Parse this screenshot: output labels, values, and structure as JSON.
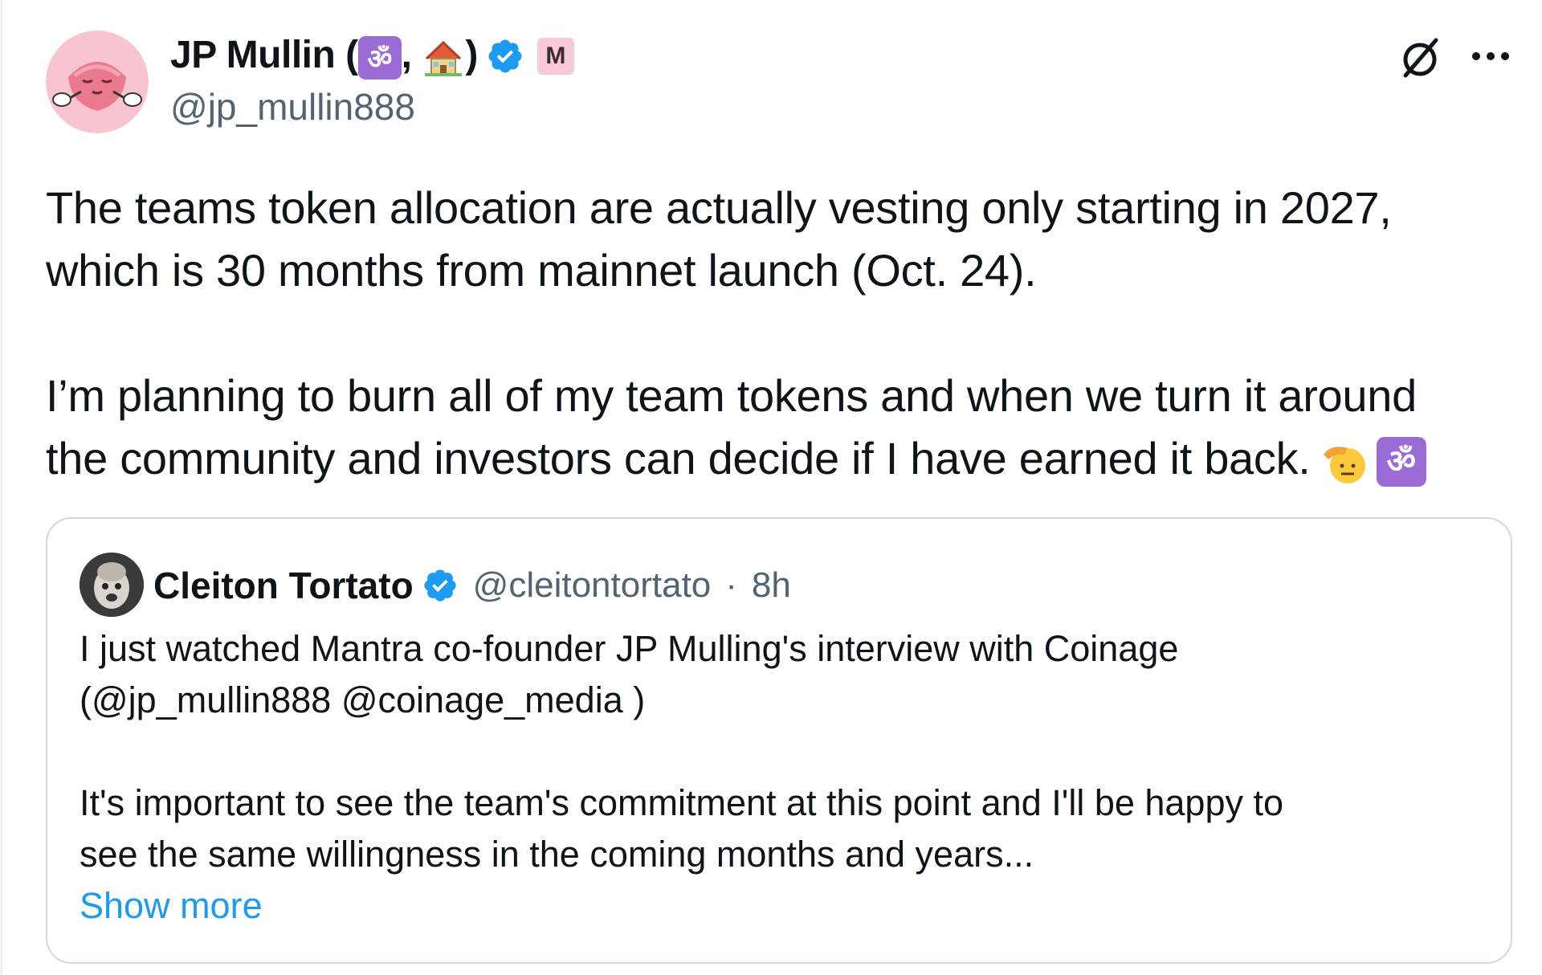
{
  "author": {
    "name_prefix": "JP Mullin (",
    "name_sep": ",",
    "name_suffix": ")",
    "om_glyph": "ॐ",
    "house_icon": "house-emoji",
    "affiliate_glyph": "M",
    "handle": "@jp_mullin888",
    "verified": true
  },
  "tweet": {
    "line1": "The teams token allocation are actually vesting only starting in 2027,",
    "line2": "which is 30 months from mainnet launch (Oct. 24).",
    "line3": "I’m planning to burn all of my team tokens and when we turn it around",
    "line4": "the community and investors can decide if I have earned it back.",
    "trailing_emojis": [
      "saluting-face-emoji",
      "om-emoji"
    ]
  },
  "quote": {
    "name": "Cleiton Tortato",
    "handle": "@cleitontortato",
    "separator": "·",
    "time": "8h",
    "line1": "I just watched Mantra co-founder JP Mulling's interview with Coinage",
    "line2": "(@jp_mullin888 @coinage_media )",
    "line3": "It's important to see the team's commitment at this point and I'll be happy to",
    "line4": "see the same willingness in the coming months and years...",
    "show_more": "Show more"
  },
  "colors": {
    "text": "#0f1419",
    "secondary": "#536471",
    "link": "#1d9bf0",
    "verified": "#1d9bf0",
    "border": "#cfd9de",
    "om_purple": "#9b6bd6"
  }
}
